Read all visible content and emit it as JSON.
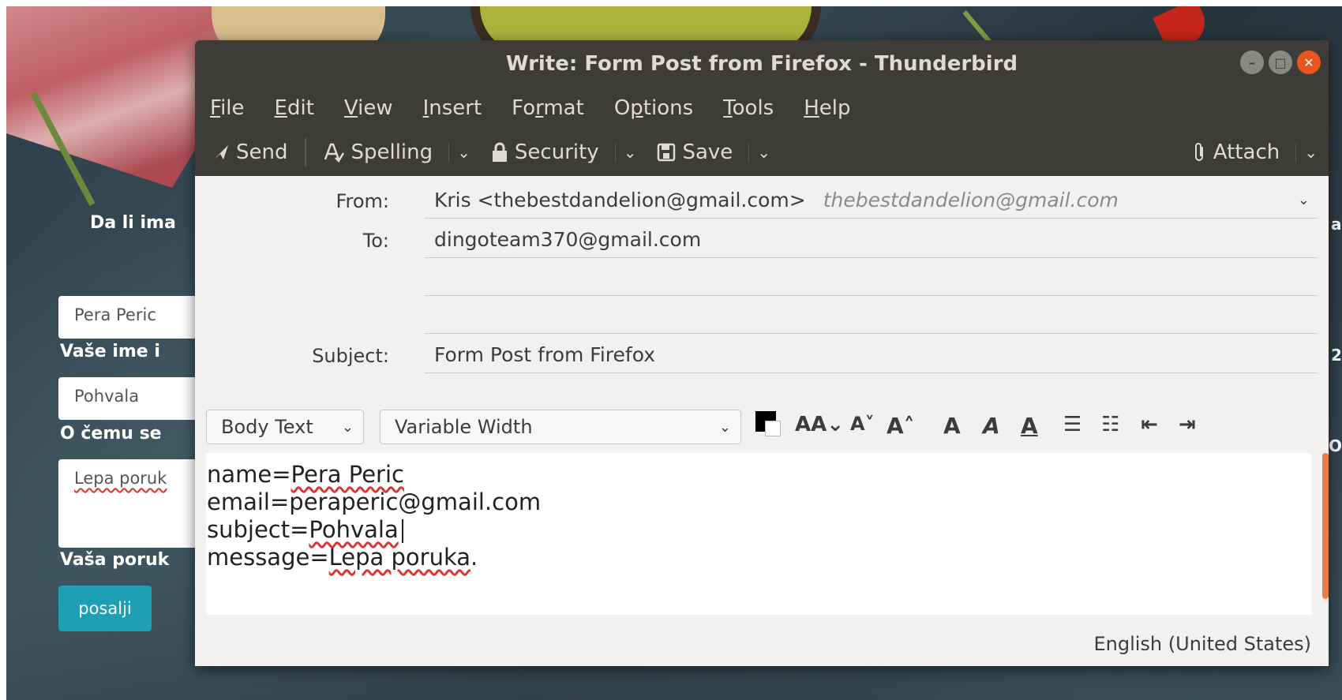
{
  "background_page": {
    "question_label": "Da li ima",
    "name_value": "Pera Peric",
    "name_label": "Vaše ime i",
    "subject_value": "Pohvala",
    "subject_label": "O čemu se",
    "message_value": "Lepa poruk",
    "message_label": "Vaša poruk",
    "submit_label": "posalji",
    "right_edge_a": "a",
    "right_edge_2": "2",
    "right_edge_o": "O"
  },
  "window": {
    "title": "Write: Form Post from Firefox - Thunderbird",
    "minimize_symbol": "–",
    "maximize_symbol": "□",
    "close_symbol": "✕"
  },
  "menu": {
    "items": [
      {
        "label": "File",
        "mnemonic": "F",
        "rest": "ile"
      },
      {
        "label": "Edit",
        "mnemonic": "E",
        "rest": "dit"
      },
      {
        "label": "View",
        "mnemonic": "V",
        "rest": "iew"
      },
      {
        "label": "Insert",
        "mnemonic": "I",
        "rest": "nsert"
      },
      {
        "label": "Format",
        "pre": "Fo",
        "mnemonic": "r",
        "rest": "mat"
      },
      {
        "label": "Options",
        "pre": "O",
        "mnemonic": "p",
        "rest": "tions"
      },
      {
        "label": "Tools",
        "mnemonic": "T",
        "rest": "ools"
      },
      {
        "label": "Help",
        "mnemonic": "H",
        "rest": "elp"
      }
    ]
  },
  "toolbar": {
    "send": "Send",
    "spelling": "Spelling",
    "security": "Security",
    "save": "Save",
    "attach": "Attach"
  },
  "headers": {
    "from_label": "From:",
    "from_value": "Kris <thebestdandelion@gmail.com>",
    "from_identity": "thebestdandelion@gmail.com",
    "to_label": "To:",
    "to_value": "dingoteam370@gmail.com",
    "subject_label": "Subject:",
    "subject_value": "Form Post from Firefox"
  },
  "format_bar": {
    "paragraph_style": "Body Text",
    "font": "Variable Width"
  },
  "body": {
    "lines": [
      {
        "key": "name=",
        "value": "Pera Peric"
      },
      {
        "key": "email=",
        "value": "peraperic@gmail.com"
      },
      {
        "key": "subject=",
        "value": "Pohvala"
      },
      {
        "key": "message=",
        "value": "Lepa poruka",
        "trail": "."
      }
    ]
  },
  "status": {
    "language": "English (United States)"
  },
  "colors": {
    "titlebar": "#3d3c38",
    "close_button": "#e9541f",
    "submit_button": "#1e9fb4"
  }
}
